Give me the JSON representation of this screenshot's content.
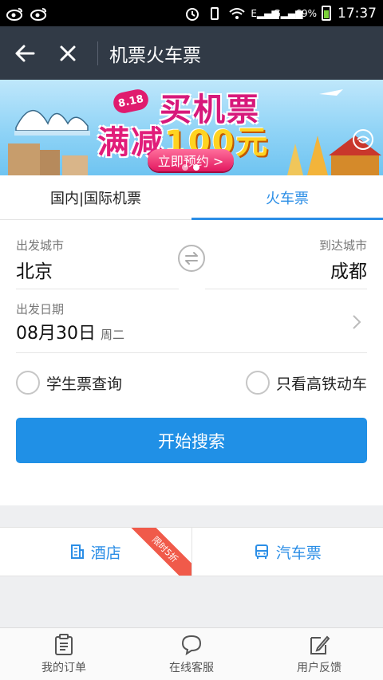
{
  "status_bar": {
    "signal_label_1": "E",
    "signal_label_2": "G",
    "battery": "69%",
    "time": "17:37"
  },
  "header": {
    "title": "机票火车票"
  },
  "banner": {
    "tag": "8.18",
    "line1": "买机票",
    "line2_prefix": "满减",
    "line2_amount": "100元",
    "button": "立即预约 >"
  },
  "tabs": [
    {
      "label": "国内|国际机票",
      "active": false
    },
    {
      "label": "火车票",
      "active": true
    }
  ],
  "form": {
    "from_label": "出发城市",
    "from_city": "北京",
    "to_label": "到达城市",
    "to_city": "成都",
    "date_label": "出发日期",
    "date_value": "08月30日",
    "date_weekday": "周二",
    "student_option": "学生票查询",
    "gaotie_option": "只看高铁动车",
    "search_button": "开始搜索"
  },
  "quick_links": {
    "hotel": "酒店",
    "hotel_ribbon": "限时5折",
    "bus": "汽车票"
  },
  "bottom_nav": [
    {
      "label": "我的订单",
      "icon": "clipboard-icon"
    },
    {
      "label": "在线客服",
      "icon": "chat-bubble-icon"
    },
    {
      "label": "用户反馈",
      "icon": "edit-icon"
    }
  ],
  "colors": {
    "accent": "#2090e6",
    "titlebar": "#313a46",
    "ribbon": "#f05a4a"
  }
}
